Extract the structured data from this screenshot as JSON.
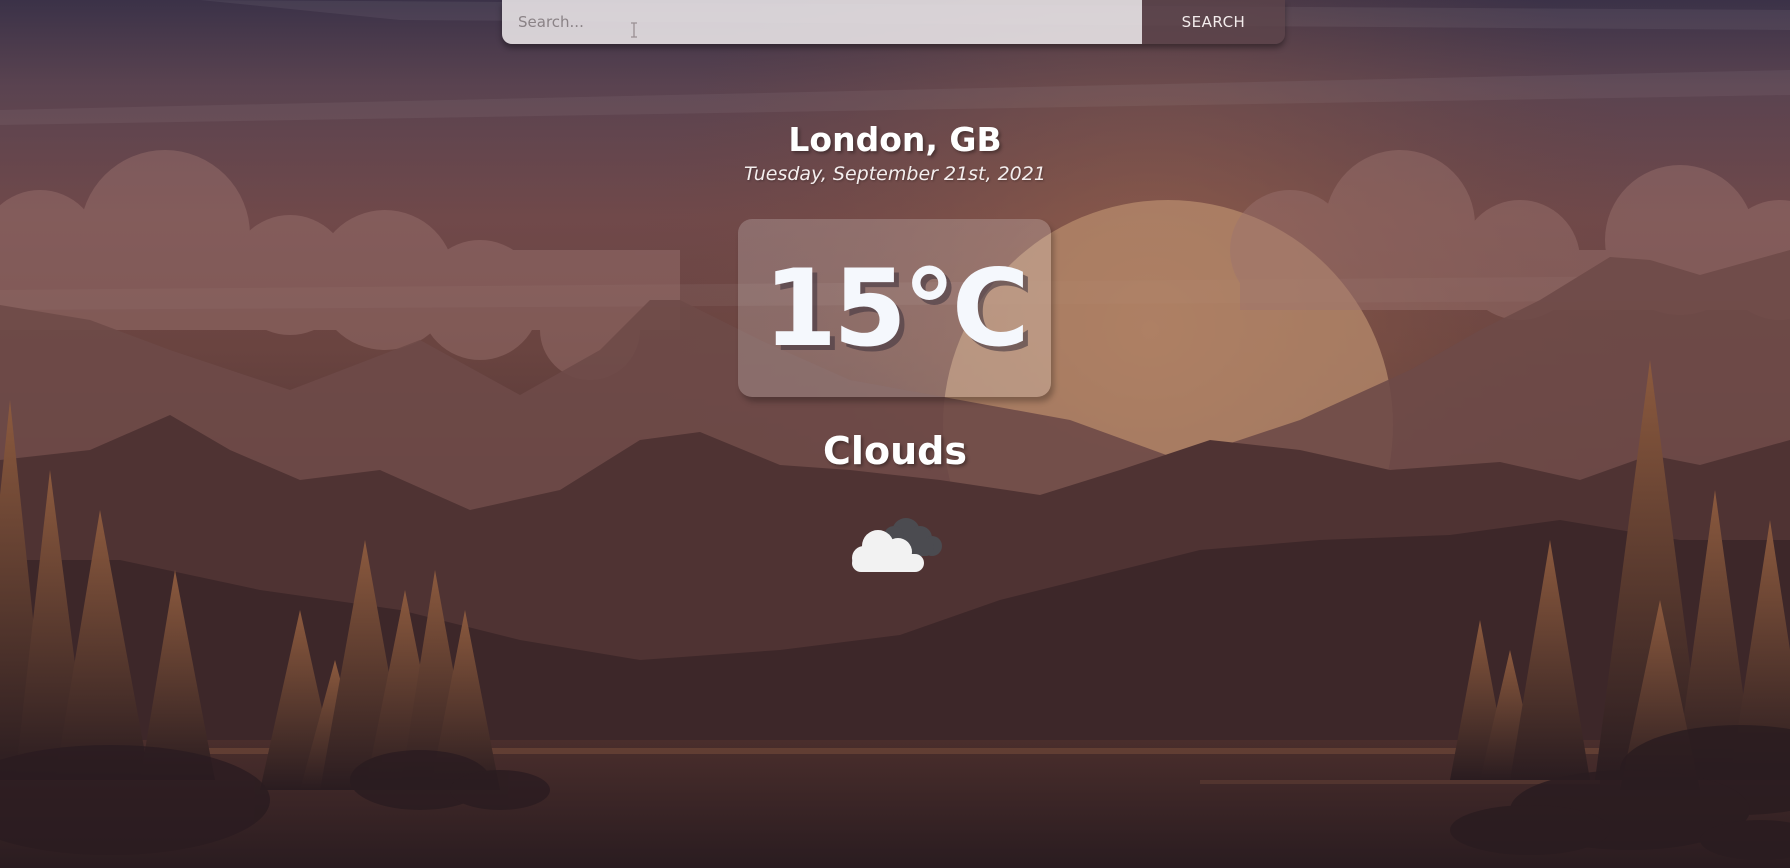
{
  "search": {
    "placeholder": "Search...",
    "value": "",
    "button_label": "SEARCH"
  },
  "weather": {
    "location": "London, GB",
    "date": "Tuesday, September 21st, 2021",
    "temperature": "15°C",
    "condition": "Clouds",
    "icon": "cloud-icon"
  },
  "colors": {
    "text": "#ffffff",
    "temperature_text": "#f5f8fd",
    "search_button_bg": "#5c444a",
    "search_input_bg": "#ebe6e8"
  }
}
